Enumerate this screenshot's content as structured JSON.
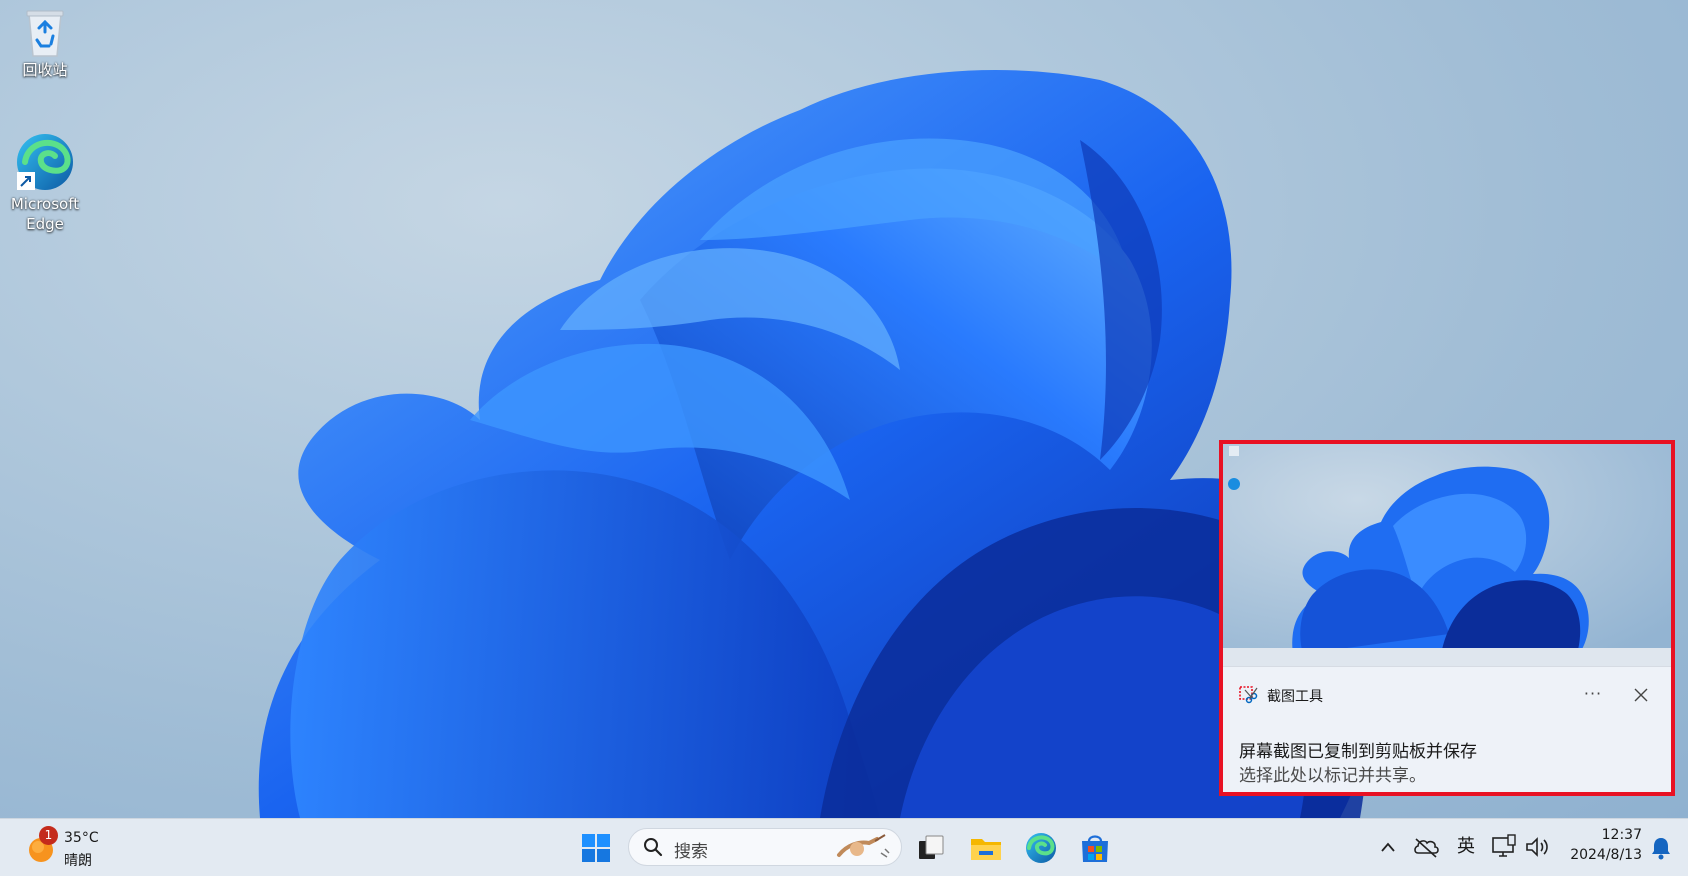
{
  "desktop": {
    "icons": [
      {
        "label": "回收站",
        "icon": "recycle-bin-icon"
      },
      {
        "label": "Microsoft\nEdge",
        "icon": "edge-icon"
      }
    ]
  },
  "toast": {
    "app_name": "截图工具",
    "app_icon": "snipping-tool-icon",
    "more_label": "···",
    "title": "屏幕截图已复制到剪贴板并保存",
    "message": "选择此处以标记并共享。",
    "highlight_color": "#e81123"
  },
  "taskbar": {
    "weather": {
      "temp": "35°C",
      "condition": "晴朗",
      "badge": "1"
    },
    "search": {
      "placeholder": "搜索"
    },
    "apps": [
      "start-icon",
      "task-view-icon",
      "file-explorer-icon",
      "edge-icon",
      "store-icon"
    ],
    "tray": {
      "ime": "英"
    },
    "clock": {
      "time": "12:37",
      "date": "2024/8/13"
    }
  },
  "colors": {
    "accent": "#0067c0",
    "taskbar_bg": "#e3eaf2",
    "badge": "#c42b1c"
  }
}
